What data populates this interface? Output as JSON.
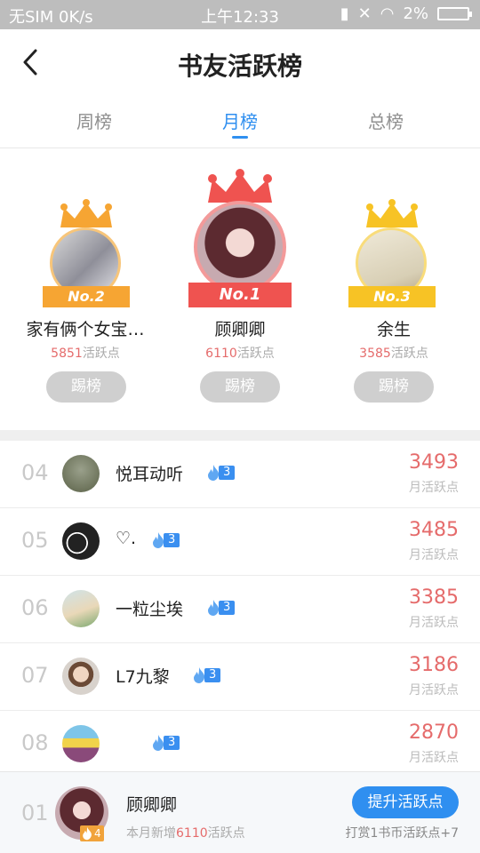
{
  "status_bar": {
    "carrier": "无SIM 0K/s",
    "time": "上午12:33",
    "battery": "2%"
  },
  "header": {
    "back_icon": "chevron-left-icon",
    "title": "书友活跃榜"
  },
  "tabs": [
    {
      "label": "周榜",
      "active": false
    },
    {
      "label": "月榜",
      "active": true
    },
    {
      "label": "总榜",
      "active": false
    }
  ],
  "podium": [
    {
      "rank_label": "No.2",
      "name": "家有俩个女宝…",
      "points": "5851",
      "points_unit": "活跃点",
      "kick": "踢榜",
      "crown_color": "#f6a533",
      "ribbon_color": "#f6a533"
    },
    {
      "rank_label": "No.1",
      "name": "顾卿卿",
      "points": "6110",
      "points_unit": "活跃点",
      "kick": "踢榜",
      "crown_color": "#ef5350",
      "ribbon_color": "#ef5350"
    },
    {
      "rank_label": "No.3",
      "name": "余生",
      "points": "3585",
      "points_unit": "活跃点",
      "kick": "踢榜",
      "crown_color": "#f7c325",
      "ribbon_color": "#f7c325"
    }
  ],
  "list": [
    {
      "rank": "04",
      "name": "悦耳动听",
      "level": "3",
      "score": "3493",
      "unit": "月活跃点"
    },
    {
      "rank": "05",
      "name": "♡.",
      "level": "3",
      "score": "3485",
      "unit": "月活跃点"
    },
    {
      "rank": "06",
      "name": "一粒尘埃",
      "level": "3",
      "score": "3385",
      "unit": "月活跃点"
    },
    {
      "rank": "07",
      "name": "L7九黎",
      "level": "3",
      "score": "3186",
      "unit": "月活跃点"
    },
    {
      "rank": "08",
      "name": "",
      "level": "3",
      "score": "2870",
      "unit": "月活跃点"
    }
  ],
  "footer": {
    "rank": "01",
    "name": "顾卿卿",
    "level": "4",
    "sub_prefix": "本月新增",
    "sub_points": "6110",
    "sub_suffix": "活跃点",
    "boost_button": "提升活跃点",
    "note": "打赏1书币活跃点+7"
  },
  "colors": {
    "accent": "#2f8ff0",
    "points": "#e56b6b",
    "badge": "#3a8ff0"
  }
}
